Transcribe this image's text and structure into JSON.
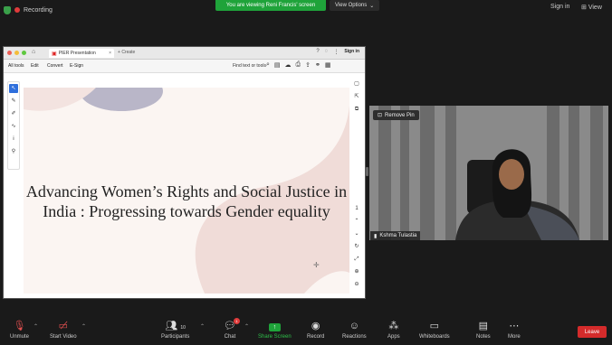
{
  "top": {
    "recording_label": "Recording",
    "viewing_banner": "You are viewing Reni Francis' screen",
    "view_options": "View Options",
    "sign_in": "Sign in",
    "view": "View"
  },
  "browser": {
    "tab_title": "PIER Presentation",
    "new_tab": "Create",
    "menu": [
      "All tools",
      "Edit",
      "Convert",
      "E-Sign"
    ],
    "find_text": "Find text or tools",
    "sign_in": "Sign in"
  },
  "slide": {
    "title": "Advancing Women’s Rights and Social Justice in India : Progressing towards Gender equality"
  },
  "video": {
    "remove_pin": "Remove Pin",
    "participant_name": "Kshma Tulastia"
  },
  "toolbar": {
    "items": [
      {
        "label": "Unmute",
        "icon": "microphone-muted-icon"
      },
      {
        "label": "Start Video",
        "icon": "video-off-icon"
      },
      {
        "label": "Participants",
        "icon": "participants-icon",
        "count": "10"
      },
      {
        "label": "Chat",
        "icon": "chat-icon",
        "badge": "1"
      },
      {
        "label": "Share Screen",
        "icon": "share-screen-icon"
      },
      {
        "label": "Record",
        "icon": "record-icon"
      },
      {
        "label": "Reactions",
        "icon": "reactions-icon"
      },
      {
        "label": "Apps",
        "icon": "apps-icon"
      },
      {
        "label": "Whiteboards",
        "icon": "whiteboard-icon"
      },
      {
        "label": "Notes",
        "icon": "notes-icon"
      },
      {
        "label": "More",
        "icon": "more-icon"
      }
    ],
    "leave": "Leave"
  },
  "colors": {
    "share_green": "#1fa33a",
    "leave_red": "#d42b2b",
    "background": "#1a1a1a"
  }
}
